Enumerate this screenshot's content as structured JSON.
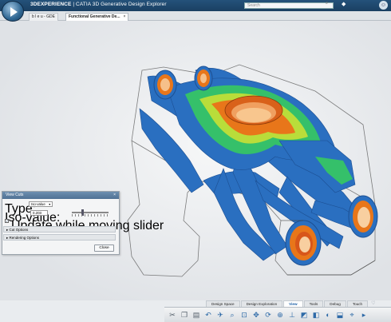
{
  "app": {
    "brand_prefix": "3DEXPERIENCE",
    "brand_separator": " | ",
    "brand_product": "CATIA 3D Generative Design Explorer",
    "search_placeholder": "Search"
  },
  "tabs": [
    {
      "label": "b l e u - GDE"
    },
    {
      "label": "Functional Generative De...",
      "close": "×"
    }
  ],
  "view_cuts_panel": {
    "title": "View Cuts",
    "close_x": "×",
    "type_label": "Type:",
    "type_value": "Iso-value",
    "iso_label": "Iso-value:",
    "iso_value": "0.203",
    "checkbox_checked": true,
    "checkbox_mark": "✓",
    "checkbox_label": "Update while moving slider",
    "cut_options": "Cut Options",
    "rendering_options": "Rendering Options",
    "section_arrow": "▸",
    "close_button": "Close"
  },
  "ribbon": {
    "tabs": [
      "Design Space",
      "Design Exploration",
      "View",
      "Tools",
      "Debug",
      "Touch"
    ],
    "active_tab": "View"
  },
  "icons": {
    "compass": "compass-play-icon",
    "search": "search-icon",
    "tag": "tag-icon",
    "profile": "profile-icon",
    "heart": "favorite-heart-icon"
  },
  "colors": {
    "topbar": "#1a3f62",
    "model_blue": "#2a6fc0",
    "model_green": "#35c06a",
    "model_orange": "#e8761a"
  }
}
